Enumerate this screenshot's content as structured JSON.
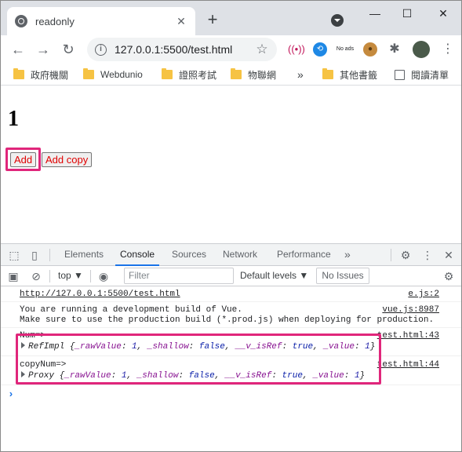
{
  "tab": {
    "title": "readonly",
    "close": "✕",
    "new": "+"
  },
  "window": {
    "minimize": "—",
    "maximize": "☐",
    "close": "✕"
  },
  "toolbar": {
    "back": "←",
    "forward": "→",
    "reload": "↻",
    "url": "127.0.0.1:5500/test.html",
    "star": "☆",
    "ext_noads": "No ads",
    "ext_puzzle": "✱"
  },
  "bookmarks": {
    "items": [
      "政府機關",
      "Webdunio",
      "證照考試",
      "物聯網"
    ],
    "overflow": "»",
    "other": "其他書籤",
    "reading": "閱讀清單"
  },
  "page": {
    "count": "1",
    "add_label": "Add",
    "add_copy_label": "Add copy"
  },
  "devtools": {
    "tabs": [
      "Elements",
      "Console",
      "Sources",
      "Network",
      "Performance"
    ],
    "active_tab": "Console",
    "more": "»",
    "context": "top ▼",
    "filter_placeholder": "Filter",
    "levels": "Default levels ▼",
    "issues": "No Issues"
  },
  "console": {
    "line1": "http://127.0.0.1:5500/test.html",
    "line1_src": "e.js:2",
    "line2a": "You are running a development build of Vue.",
    "line2b": "Make sure to use the production build (*.prod.js) when deploying for production.",
    "line2_src": "vue.js:8987",
    "num_label": "Num=>",
    "num_src": "test.html:43",
    "num_obj": "RefImpl",
    "copy_label": "copyNum=>",
    "copy_src": "test.html:44",
    "copy_obj": "Proxy",
    "raw_key": "_rawValue",
    "raw_val": "1",
    "shallow_key": "_shallow",
    "shallow_val": "false",
    "isref_key": "__v_isRef",
    "isref_val": "true",
    "value_key": "_value",
    "value_val": "1",
    "prompt": "›"
  },
  "colors": {
    "highlight": "#e0267b",
    "button_text": "#e00000",
    "active_tab": "#1a73e8"
  }
}
